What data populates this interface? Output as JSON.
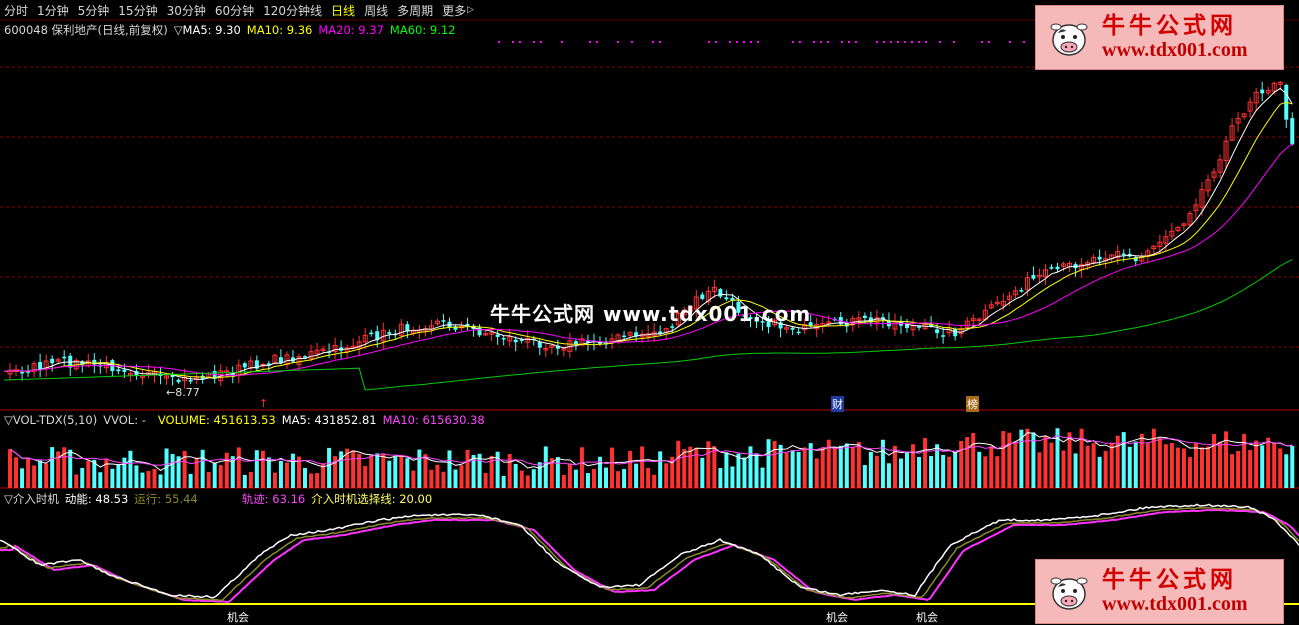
{
  "toolbar": {
    "items": [
      "分时",
      "1分钟",
      "5分钟",
      "15分钟",
      "30分钟",
      "60分钟",
      "120分钟线",
      "日线",
      "周线",
      "多周期",
      "更多"
    ],
    "active_index": 7,
    "more_arrow": "▷"
  },
  "price_header": {
    "stock": "600048 保利地产(日线,前复权)",
    "marker": "▽",
    "ma5": "MA5: 9.30",
    "ma10": "MA10: 9.36",
    "ma20": "MA20: 9.37",
    "ma60": "MA60: 9.12",
    "colors": {
      "ma5": "#ffffff",
      "ma10": "#ffff00",
      "ma20": "#ff00ff",
      "ma60": "#00ff00"
    }
  },
  "price_annotations": {
    "low_label": "←8.77",
    "event_cai": "财",
    "event_bang": "榜",
    "event_up": "↑"
  },
  "center_watermark": "牛牛公式网 www.tdx001.com",
  "watermark": {
    "title": "牛牛公式网",
    "url": "www.tdx001.com",
    "cow_icon": "cow-mascot-icon"
  },
  "vol_header": {
    "name": "▽VOL-TDX(5,10)",
    "vvol": "VVOL: -",
    "volume": "VOLUME: 451613.53",
    "ma5": "MA5: 431852.81",
    "ma10": "MA10: 615630.38"
  },
  "ind_header": {
    "name": "▽介入时机",
    "dongneng": "动能: 48.53",
    "yunxing": "运行: 55.44",
    "guiji": "轨迹: 63.16",
    "line": "介入时机选择线: 20.00"
  },
  "signals": {
    "label": "机会"
  },
  "colors": {
    "up": "#ff3232",
    "down": "#54ffff",
    "grid": "#8b0000",
    "separator": "#b00000",
    "threshold": "#ffff00"
  },
  "chart_data": {
    "type": "candlestick",
    "symbol": "600048",
    "panels": [
      "price",
      "volume",
      "indicator"
    ],
    "price_last": {
      "MA5": 9.3,
      "MA10": 9.36,
      "MA20": 9.37,
      "MA60": 9.12
    },
    "price_low_marked": 8.77,
    "volume_last": {
      "VOLUME": 451613.53,
      "MA5": 431852.81,
      "MA10": 615630.38
    },
    "indicator_last": {
      "动能": 48.53,
      "运行": 55.44,
      "轨迹": 63.16,
      "介入时机选择线": 20.0
    },
    "signal_count": 3
  }
}
